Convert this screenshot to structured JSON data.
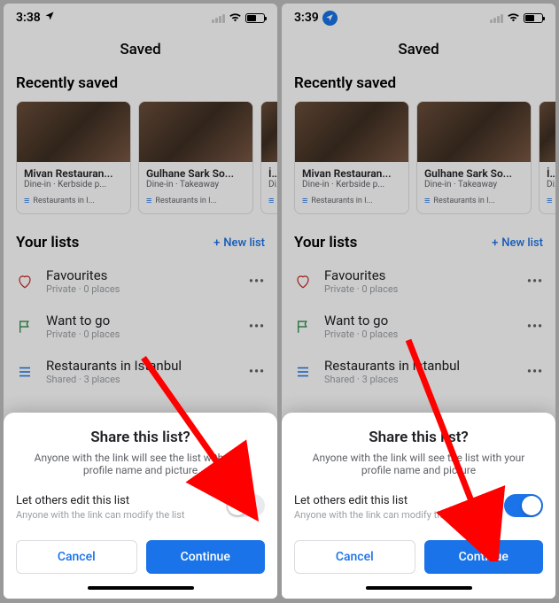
{
  "left": {
    "status": {
      "time": "3:38",
      "loc_style": "outline",
      "battery": 0.52
    },
    "header": {
      "title": "Saved"
    },
    "recent": {
      "title": "Recently saved",
      "cards": [
        {
          "title": "Mivan Restauran...",
          "sub": "Dine-in · Kerbside p...",
          "tag": "Restaurants in I..."
        },
        {
          "title": "Gulhane Sark So...",
          "sub": "Dine-in · Takeaway",
          "tag": "Restaurants in I..."
        },
        {
          "title": "İstan",
          "sub": "Dine",
          "tag": "R"
        }
      ]
    },
    "lists": {
      "title": "Your lists",
      "new": "New list",
      "items": [
        {
          "title": "Favourites",
          "sub": "Private · 0 places",
          "icon": "heart"
        },
        {
          "title": "Want to go",
          "sub": "Private · 0 places",
          "icon": "flag"
        },
        {
          "title": "Restaurants in Istanbul",
          "sub": "Shared · 3 places",
          "icon": "list"
        }
      ]
    },
    "sheet": {
      "title": "Share this list?",
      "desc": "Anyone with the link will see the list with your profile name and picture",
      "edit": "Let others edit this list",
      "edit_sub": "Anyone with the link can modify the list",
      "toggle": "off",
      "cancel": "Cancel",
      "continue": "Continue"
    }
  },
  "right": {
    "status": {
      "time": "3:39",
      "loc_style": "bubble",
      "battery": 0.48
    },
    "header": {
      "title": "Saved"
    },
    "recent": {
      "title": "Recently saved",
      "cards": [
        {
          "title": "Mivan Restauran...",
          "sub": "Dine-in · Kerbside p...",
          "tag": "Restaurants in I..."
        },
        {
          "title": "Gulhane Sark So...",
          "sub": "Dine-in · Takeaway",
          "tag": "Restaurants in I..."
        },
        {
          "title": "İstan",
          "sub": "Dine",
          "tag": "R"
        }
      ]
    },
    "lists": {
      "title": "Your lists",
      "new": "New list",
      "items": [
        {
          "title": "Favourites",
          "sub": "Private · 0 places",
          "icon": "heart"
        },
        {
          "title": "Want to go",
          "sub": "Private · 0 places",
          "icon": "flag"
        },
        {
          "title": "Restaurants in Istanbul",
          "sub": "Shared · 3 places",
          "icon": "list"
        }
      ]
    },
    "sheet": {
      "title": "Share this list?",
      "desc": "Anyone with the link will see the list with your profile name and picture",
      "edit": "Let others edit this list",
      "edit_sub": "Anyone with the link can modify the list",
      "toggle": "on",
      "cancel": "Cancel",
      "continue": "Continue"
    }
  }
}
